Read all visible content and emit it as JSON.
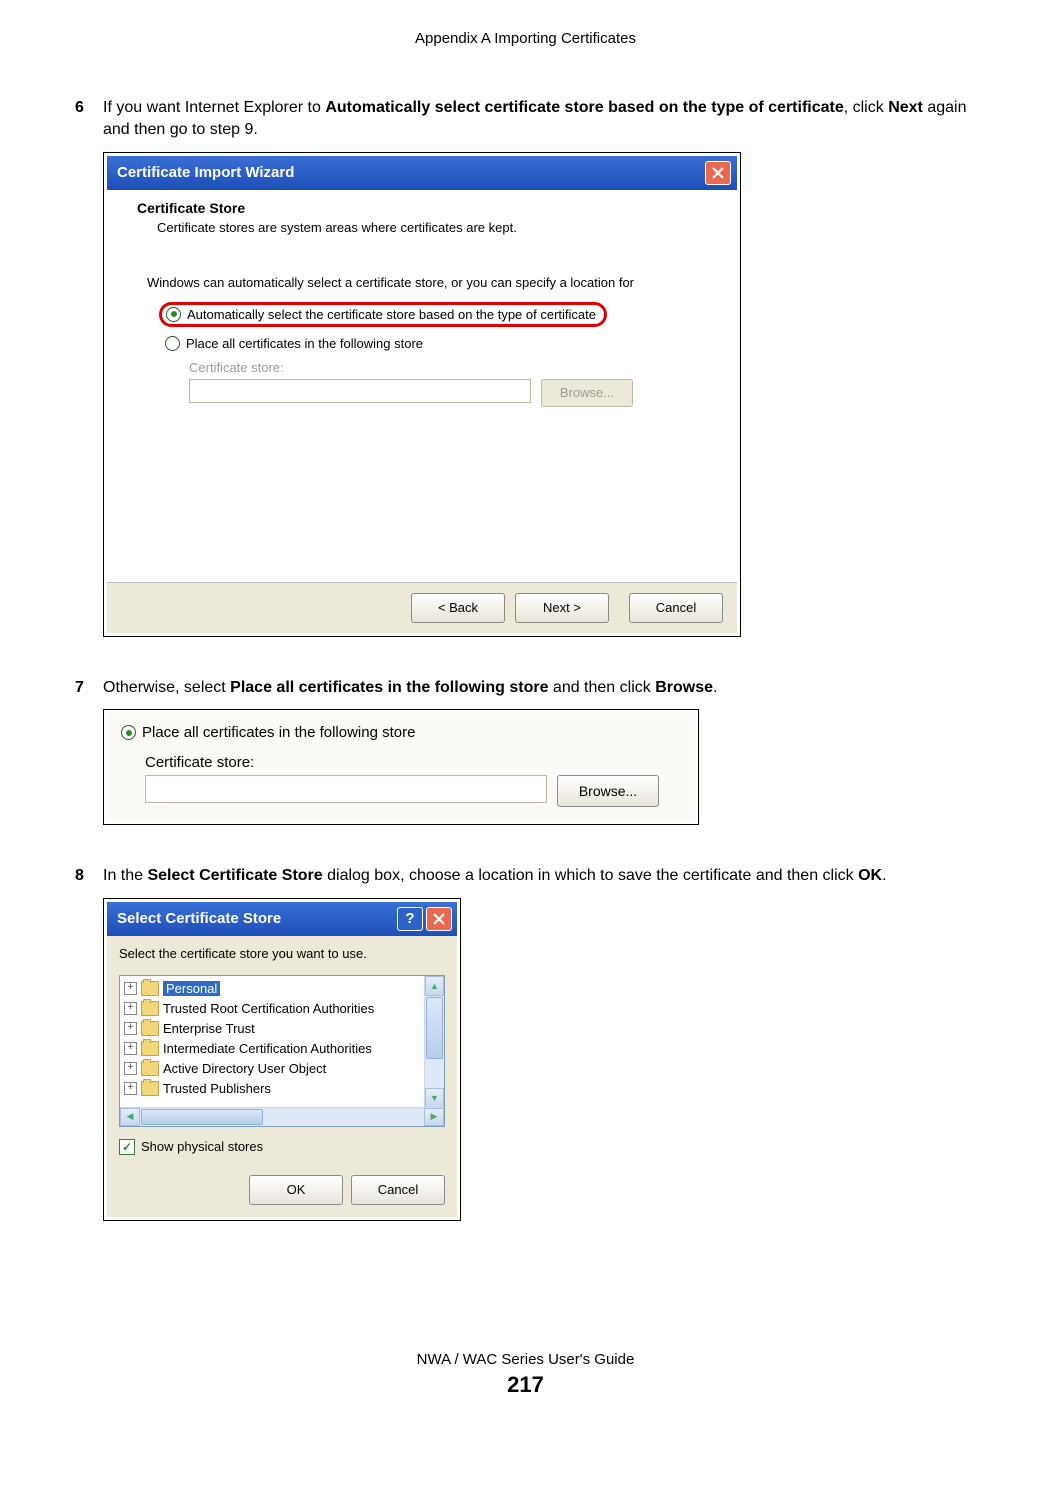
{
  "header": {
    "appendix_title": "Appendix A Importing Certificates"
  },
  "steps": {
    "s6": {
      "num": "6",
      "text_pre": "If you want Internet Explorer to ",
      "bold1": "Automatically select certificate store based on the type of certificate",
      "text_mid": ", click ",
      "bold2": "Next",
      "text_post": " again and then go to step 9."
    },
    "s7": {
      "num": "7",
      "text_pre": "Otherwise, select ",
      "bold1": "Place all certificates in the following store",
      "text_mid": " and then click ",
      "bold2": "Browse",
      "text_post": "."
    },
    "s8": {
      "num": "8",
      "text_pre": "In the ",
      "bold1": "Select Certificate Store",
      "text_mid": " dialog box, choose a location in which to save the certificate and then click ",
      "bold2": "OK",
      "text_post": "."
    }
  },
  "dialog1": {
    "title": "Certificate Import Wizard",
    "heading": "Certificate Store",
    "subtext": "Certificate stores are system areas where certificates are kept.",
    "instruction": "Windows can automatically select a certificate store, or you can specify a location for",
    "opt_auto": "Automatically select the certificate store based on the type of certificate",
    "opt_place": "Place all certificates in the following store",
    "store_label": "Certificate store:",
    "browse": "Browse...",
    "back": "< Back",
    "next": "Next >",
    "cancel": "Cancel"
  },
  "dialog2": {
    "opt_place": "Place all certificates in the following store",
    "store_label": "Certificate store:",
    "browse": "Browse..."
  },
  "dialog3": {
    "title": "Select Certificate Store",
    "instruction": "Select the certificate store you want to use.",
    "items": {
      "i0": "Personal",
      "i1": "Trusted Root Certification Authorities",
      "i2": "Enterprise Trust",
      "i3": "Intermediate Certification Authorities",
      "i4": "Active Directory User Object",
      "i5": "Trusted Publishers"
    },
    "show_physical": "Show physical stores",
    "ok": "OK",
    "cancel": "Cancel"
  },
  "footer": {
    "guide": "NWA / WAC Series User's Guide",
    "page": "217"
  }
}
